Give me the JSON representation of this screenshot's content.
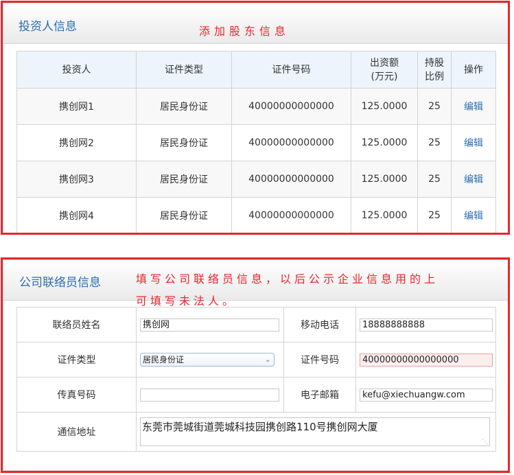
{
  "investors_section": {
    "title": "投资人信息",
    "annotation": "添加股东信息",
    "columns": [
      "投资人",
      "证件类型",
      "证件号码",
      "出资额\n(万元)",
      "持股\n比例",
      "操作"
    ],
    "col_amount_line1": "出资额",
    "col_amount_line2": "(万元)",
    "col_ratio_line1": "持股",
    "col_ratio_line2": "比例",
    "rows": [
      {
        "name": "携创网1",
        "id_type": "居民身份证",
        "id_no": "40000000000000",
        "amount": "125.0000",
        "ratio": "25",
        "action": "编辑"
      },
      {
        "name": "携创网2",
        "id_type": "居民身份证",
        "id_no": "40000000000000",
        "amount": "125.0000",
        "ratio": "25",
        "action": "编辑"
      },
      {
        "name": "携创网3",
        "id_type": "居民身份证",
        "id_no": "40000000000000",
        "amount": "125.0000",
        "ratio": "25",
        "action": "编辑"
      },
      {
        "name": "携创网4",
        "id_type": "居民身份证",
        "id_no": "40000000000000",
        "amount": "125.0000",
        "ratio": "25",
        "action": "编辑"
      }
    ]
  },
  "contact_section": {
    "title": "公司联络员信息",
    "annotation_line1": "填写公司联络员信息，以后公示企业信息用的上",
    "annotation_line2": "可填写未法人。",
    "labels": {
      "name": "联络员姓名",
      "mobile": "移动电话",
      "id_type": "证件类型",
      "id_no": "证件号码",
      "fax": "传真号码",
      "email": "电子邮箱",
      "address": "通信地址"
    },
    "values": {
      "name": "携创网",
      "mobile": "18888888888",
      "id_type": "居民身份证",
      "id_no": "40000000000000000",
      "fax": "",
      "email": "kefu@xiechuangw.com",
      "address": "东莞市莞城街道莞城科技园携创路110号携创网大厦"
    }
  },
  "colors": {
    "annotation_red": "#e8262b",
    "title_blue": "#2a6db3",
    "header_bg": "#edf4fb"
  }
}
